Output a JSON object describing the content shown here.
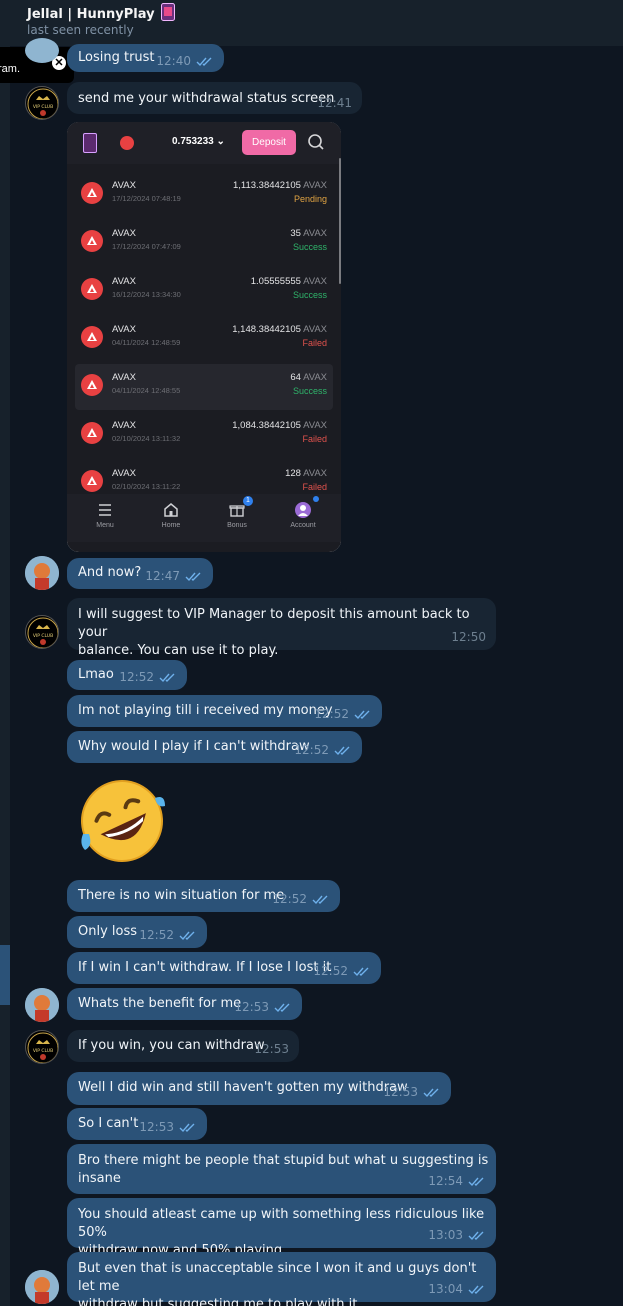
{
  "header": {
    "title": "Jellal | HunnyPlay",
    "status": "last seen recently"
  },
  "tooltip": {
    "text": "ram."
  },
  "messages": [
    {
      "text": "Losing trust",
      "time": "12:40"
    },
    {
      "text": "send me your withdrawal status screen",
      "time": "12:41"
    },
    {
      "text": "And now?",
      "time": "12:47"
    },
    {
      "text1": "I will suggest to VIP Manager to deposit this amount back to your",
      "text2": "balance. You can use it to play.",
      "time": "12:50"
    },
    {
      "text": "Lmao",
      "time": "12:52"
    },
    {
      "text": "Im not playing till i received my money",
      "time": "12:52"
    },
    {
      "text": "Why would I play if I can't withdraw",
      "time": "12:52"
    },
    {
      "text": "There is no win situation for me",
      "time": "12:52"
    },
    {
      "text": "Only loss",
      "time": "12:52"
    },
    {
      "text": "If I win I can't withdraw. If I lose I lost it",
      "time": "12:52"
    },
    {
      "text": "Whats the benefit for me",
      "time": "12:53"
    },
    {
      "text": "If you win, you can withdraw",
      "time": "12:53"
    },
    {
      "text": "Well I did win and still haven't gotten my withdraw",
      "time": "12:53"
    },
    {
      "text": "So I can't",
      "time": "12:53"
    },
    {
      "text1": "Bro there might be people that stupid but what u suggesting is",
      "text2": "insane",
      "time": "12:54"
    },
    {
      "text1": "You should atleast came up with something less ridiculous like 50%",
      "text2": "withdraw now and 50% playing",
      "time": "13:03"
    },
    {
      "text1": "But even that is unacceptable since I won it and u guys don't let me",
      "text2": "withdraw but suggesting me to play with it",
      "time": "13:04"
    }
  ],
  "app": {
    "balance": "0.753233",
    "deposit_label": "Deposit",
    "transactions": [
      {
        "coin": "AVAX",
        "date": "17/12/2024 07:48:19",
        "amount": "1,113.38442105",
        "unit": "AVAX",
        "status": "Pending"
      },
      {
        "coin": "AVAX",
        "date": "17/12/2024 07:47:09",
        "amount": "35",
        "unit": "AVAX",
        "status": "Success"
      },
      {
        "coin": "AVAX",
        "date": "16/12/2024 13:34:30",
        "amount": "1.05555555",
        "unit": "AVAX",
        "status": "Success"
      },
      {
        "coin": "AVAX",
        "date": "04/11/2024 12:48:59",
        "amount": "1,148.38442105",
        "unit": "AVAX",
        "status": "Failed"
      },
      {
        "coin": "AVAX",
        "date": "04/11/2024 12:48:55",
        "amount": "64",
        "unit": "AVAX",
        "status": "Success"
      },
      {
        "coin": "AVAX",
        "date": "02/10/2024 13:11:32",
        "amount": "1,084.38442105",
        "unit": "AVAX",
        "status": "Failed"
      },
      {
        "coin": "AVAX",
        "date": "02/10/2024 13:11:22",
        "amount": "128",
        "unit": "AVAX",
        "status": "Failed"
      }
    ],
    "nav": [
      "Menu",
      "Home",
      "Bonus",
      "Account"
    ],
    "bonus_badge": "1"
  },
  "colors": {
    "bg": "#0e1621",
    "outgoing": "#2b5278",
    "incoming": "#182533",
    "pending": "#e0a343",
    "success": "#2fb36a",
    "failed": "#e0524d"
  },
  "icons": [
    "close-icon",
    "double-check-icon",
    "avax-icon",
    "search-icon",
    "menu-icon",
    "home-icon",
    "bonus-icon",
    "account-icon",
    "rofl-emoji"
  ]
}
